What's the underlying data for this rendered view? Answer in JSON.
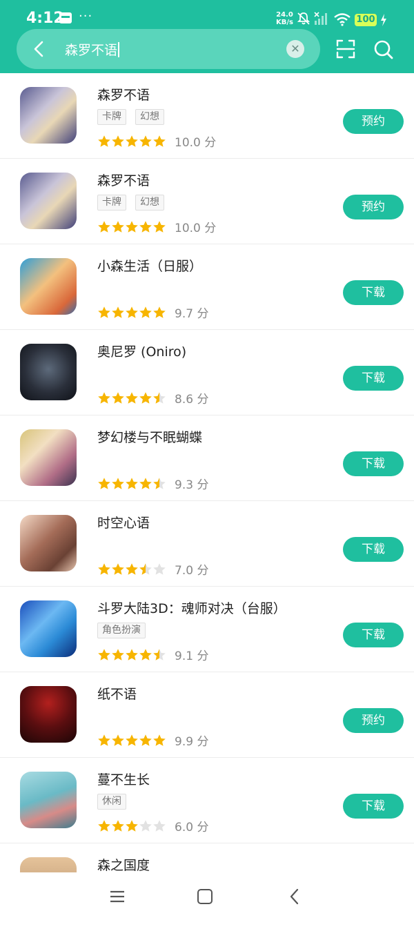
{
  "status": {
    "time": "4:12",
    "more": "···",
    "speed_value": "24.0",
    "speed_unit": "KB/s",
    "battery": "100"
  },
  "search": {
    "query": "森罗不语"
  },
  "colors": {
    "accent": "#1fbf9f",
    "star": "#f7b500",
    "star_empty": "#e2e2e2"
  },
  "apps": [
    {
      "title": "森罗不语",
      "tags": [
        "卡牌",
        "幻想"
      ],
      "rating": 5,
      "score": "10.0 分",
      "action": "预约"
    },
    {
      "title": "森罗不语",
      "tags": [
        "卡牌",
        "幻想"
      ],
      "rating": 5,
      "score": "10.0 分",
      "action": "预约"
    },
    {
      "title": "小森生活（日服）",
      "tags": [],
      "rating": 5,
      "score": "9.7 分",
      "action": "下载"
    },
    {
      "title": "奥尼罗 (Oniro)",
      "tags": [],
      "rating": 4.5,
      "score": "8.6 分",
      "action": "下载"
    },
    {
      "title": "梦幻楼与不眠蝴蝶",
      "tags": [],
      "rating": 4.5,
      "score": "9.3 分",
      "action": "下载"
    },
    {
      "title": "时空心语",
      "tags": [],
      "rating": 3.5,
      "score": "7.0 分",
      "action": "下载"
    },
    {
      "title": "斗罗大陆3D：魂师对决（台服）",
      "tags": [
        "角色扮演"
      ],
      "rating": 4.5,
      "score": "9.1 分",
      "action": "下载"
    },
    {
      "title": "纸不语",
      "tags": [],
      "rating": 5,
      "score": "9.9 分",
      "action": "预约"
    },
    {
      "title": "蔓不生长",
      "tags": [
        "休闲"
      ],
      "rating": 3,
      "score": "6.0 分",
      "action": "下载"
    },
    {
      "title": "森之国度",
      "tags": [],
      "rating": 0,
      "score": "",
      "action": ""
    }
  ]
}
